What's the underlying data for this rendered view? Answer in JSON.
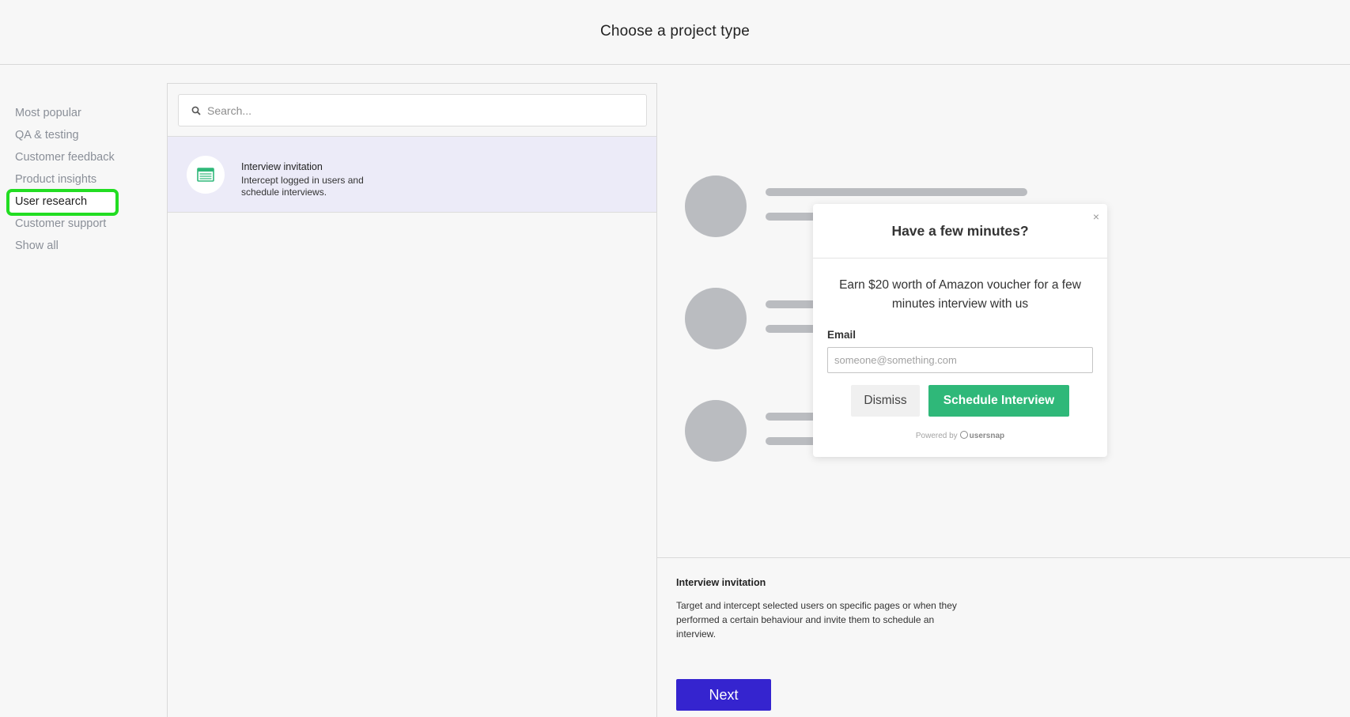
{
  "header": {
    "title": "Choose a project type"
  },
  "sidebar": {
    "items": [
      {
        "label": "Most popular"
      },
      {
        "label": "QA & testing"
      },
      {
        "label": "Customer feedback"
      },
      {
        "label": "Product insights"
      },
      {
        "label": "User research"
      },
      {
        "label": "Customer support"
      },
      {
        "label": "Show all"
      }
    ],
    "active": "User research"
  },
  "search": {
    "placeholder": "Search...",
    "value": "",
    "icon": "search-icon"
  },
  "list": {
    "items": [
      {
        "title": "Interview invitation",
        "description": "Intercept logged in users and schedule interviews.",
        "icon": "calendar-table-icon"
      }
    ]
  },
  "preview": {
    "modal": {
      "title": "Have a few minutes?",
      "close_label": "×",
      "body": "Earn $20 worth of Amazon voucher for a few minutes interview with us",
      "email_label": "Email",
      "email_placeholder": "someone@something.com",
      "dismiss_label": "Dismiss",
      "schedule_label": "Schedule Interview",
      "powered_by": "Powered by",
      "brand": "usersnap"
    }
  },
  "details": {
    "title": "Interview invitation",
    "body": "Target and intercept selected users on specific pages or when they performed a certain behaviour and invite them to schedule an interview."
  },
  "actions": {
    "next_label": "Next"
  },
  "colors": {
    "accent": "#3524cf",
    "highlight_ring": "#22dd22",
    "selected_row": "#ecebf8",
    "schedule_button": "#2fb879",
    "item_icon": "#2fb879"
  }
}
